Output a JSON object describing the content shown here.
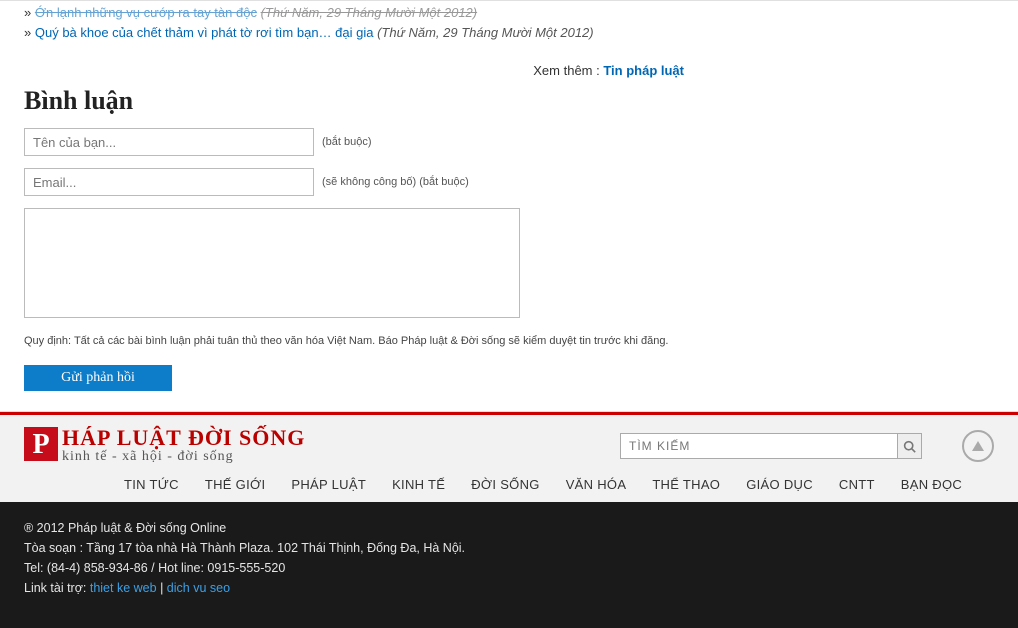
{
  "related": {
    "item1": {
      "text": "Ớn lạnh những vụ cướp ra tay tàn độc",
      "date": "(Thứ Năm, 29 Tháng Mười Một 2012)"
    },
    "item2": {
      "text": "Quý bà khoe của chết thảm vì phát tờ rơi tìm bạn… đại gia",
      "date": "(Thứ Năm, 29 Tháng Mười Một 2012)"
    }
  },
  "see_more": {
    "prefix": "Xem thêm : ",
    "link": "Tin pháp luật"
  },
  "comment": {
    "heading": "Bình luận",
    "name_placeholder": "Tên của bạn...",
    "name_hint": "(bắt buộc)",
    "email_placeholder": "Email...",
    "email_hint": "(sẽ không công bố) (bắt buộc)",
    "rule": "Quy định: Tất cả các bài bình luận phải tuân thủ theo văn hóa Việt Nam. Báo Pháp luật & Đời sống sẽ kiểm duyệt tin trước khi đăng.",
    "submit": "Gửi phản hồi"
  },
  "footer": {
    "logo_p": "P",
    "logo_main": "háp luật đời sống",
    "logo_sub": "kinh tế - xã hội - đời sống",
    "search_placeholder": "TÌM KIẾM",
    "nav": {
      "n0": "TIN TỨC",
      "n1": "THẾ GIỚI",
      "n2": "PHÁP LUẬT",
      "n3": "KINH TẾ",
      "n4": "ĐỜI SỐNG",
      "n5": "VĂN HÓA",
      "n6": "THỂ THAO",
      "n7": "GIÁO DỤC",
      "n8": "CNTT",
      "n9": "BẠN ĐỌC"
    },
    "info": {
      "copyright": "® 2012 Pháp luật & Đời sống Online",
      "address": "Tòa soạn : Tầng 17 tòa nhà Hà Thành Plaza. 102 Thái Thịnh, Đống Đa, Hà Nội.",
      "tel": "Tel: (84-4) 858-934-86 / Hot line: 0915-555-520",
      "sponsor_prefix": "Link tài trợ: ",
      "sponsor_link1": "thiet ke web",
      "sponsor_sep": " | ",
      "sponsor_link2": "dich vu seo"
    }
  }
}
